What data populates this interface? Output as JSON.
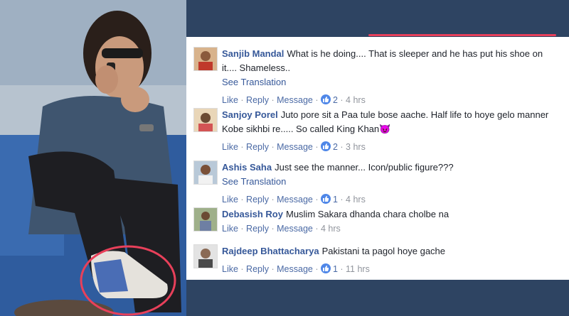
{
  "comments": [
    {
      "name": "Sanjib Mandal",
      "text": "What is he doing.... That is sleeper and he has put his shoe on it.... Shameless..",
      "see_translation": "See Translation",
      "actions": {
        "like": "Like",
        "reply": "Reply",
        "message": "Message",
        "likes": "2",
        "time": "4 hrs"
      }
    },
    {
      "name": "Sanjoy Porel",
      "text": "Juto pore sit a Paa tule bose aache. Half life to hoye gelo manner Kobe sikhbi re..... So called King Khan",
      "emoji": "😈",
      "actions": {
        "like": "Like",
        "reply": "Reply",
        "message": "Message",
        "likes": "2",
        "time": "3 hrs"
      }
    },
    {
      "name": "Ashis Saha",
      "text": "Just see the manner... Icon/public figure???",
      "see_translation": "See Translation",
      "actions": {
        "like": "Like",
        "reply": "Reply",
        "message": "Message",
        "likes": "1",
        "time": "4 hrs"
      }
    },
    {
      "name": "Debasish Roy",
      "text": "Muslim Sakara dhanda chara cholbe na",
      "actions": {
        "like": "Like",
        "reply": "Reply",
        "message": "Message",
        "time": "4 hrs"
      }
    },
    {
      "name": "Rajdeep Bhattacharya",
      "text": "Pakistani ta pagol hoye gache",
      "actions": {
        "like": "Like",
        "reply": "Reply",
        "message": "Message",
        "likes": "1",
        "time": "11 hrs"
      }
    }
  ],
  "colors": {
    "link": "#365899",
    "action": "#4b6aa5",
    "muted": "#90949c",
    "background": "#2e4462",
    "highlight_circle": "#e8405a"
  }
}
